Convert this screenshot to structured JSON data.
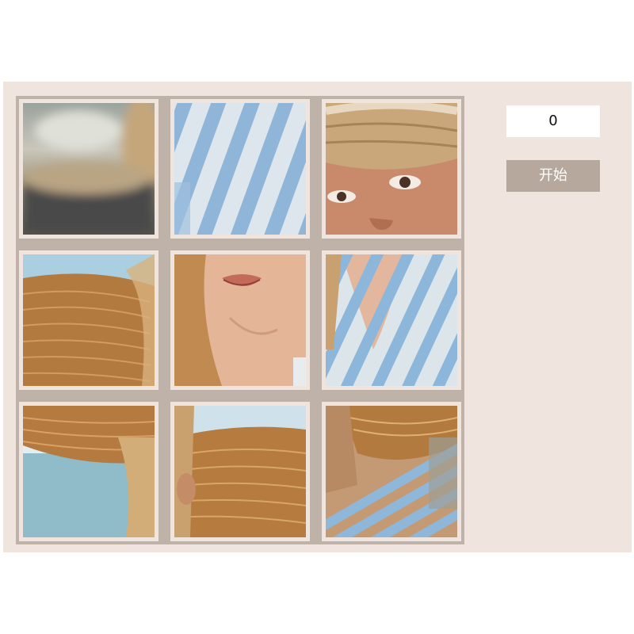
{
  "counter": {
    "value": "0"
  },
  "controls": {
    "start_label": "开始"
  },
  "board": {
    "grid_size": 3,
    "tiles": [
      {
        "name": "tile-blurred-background"
      },
      {
        "name": "tile-striped-shirt-shoulder"
      },
      {
        "name": "tile-eyes-under-hat"
      },
      {
        "name": "tile-hat-brim-left"
      },
      {
        "name": "tile-lips-and-chin"
      },
      {
        "name": "tile-striped-collar"
      },
      {
        "name": "tile-hat-brim-hair"
      },
      {
        "name": "tile-hat-brim-ear"
      },
      {
        "name": "tile-hat-and-stripes"
      }
    ]
  },
  "colors": {
    "app_background": "#f0e5de",
    "board_border": "#bfb2a9",
    "button_background": "#b7a89d"
  }
}
